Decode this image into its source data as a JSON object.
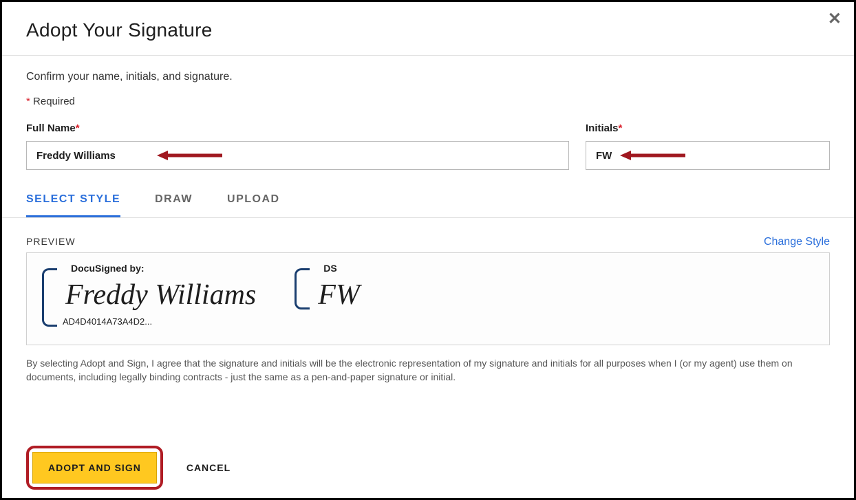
{
  "header": {
    "title": "Adopt Your Signature"
  },
  "instruction": "Confirm your name, initials, and signature.",
  "required_note": "Required",
  "form": {
    "full_name_label": "Full Name",
    "full_name_value": "Freddy Williams",
    "initials_label": "Initials",
    "initials_value": "FW"
  },
  "tabs": {
    "select_style": "SELECT STYLE",
    "draw": "DRAW",
    "upload": "UPLOAD"
  },
  "preview": {
    "label": "PREVIEW",
    "change_style": "Change Style",
    "docusigned_by": "DocuSigned by:",
    "ds_label": "DS",
    "signature_text": "Freddy Williams",
    "initials_text": "FW",
    "hash": "AD4D4014A73A4D2..."
  },
  "disclaimer": "By selecting Adopt and Sign, I agree that the signature and initials will be the electronic representation of my signature and initials for all purposes when I (or my agent) use them on documents, including legally binding contracts - just the same as a pen-and-paper signature or initial.",
  "footer": {
    "adopt_label": "ADOPT AND SIGN",
    "cancel_label": "CANCEL"
  }
}
